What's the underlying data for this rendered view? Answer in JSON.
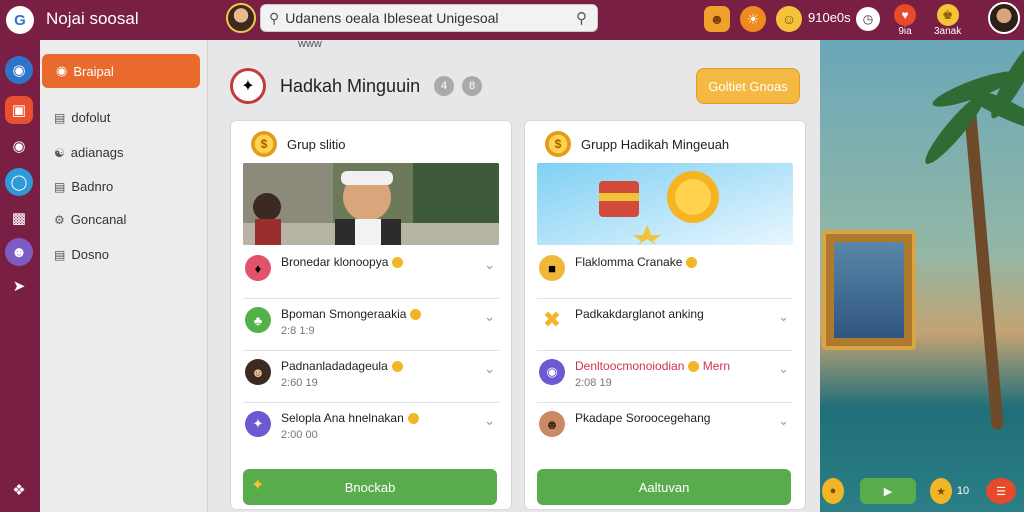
{
  "app": {
    "title": "Nojai soosal",
    "logo_letter": "G"
  },
  "search": {
    "value": "Udanens oeala Ibleseat Unigesoal"
  },
  "top_status": {
    "text": "910e0s"
  },
  "top_minis": [
    {
      "label": "9ia"
    },
    {
      "label": "3anak"
    }
  ],
  "sidebar": {
    "active": "Braipal",
    "items": [
      {
        "label": "dofolut"
      },
      {
        "label": "adianags"
      },
      {
        "label": "Badnro"
      },
      {
        "label": "Goncanal"
      },
      {
        "label": "Dosno"
      }
    ]
  },
  "main": {
    "faded_row": "www",
    "title": "Hadkah Minguuin",
    "badge1": "4",
    "badge2": "8",
    "action_button": "Goltiet Gnoas"
  },
  "left_card": {
    "title": "Grup slitio",
    "rows": [
      {
        "label": "Bronedar klonoopya",
        "sub": ""
      },
      {
        "label": "Bpoman Smongeraakia",
        "sub": "2:8 1:9"
      },
      {
        "label": "Padnanladadageula",
        "sub": "2:60 19"
      },
      {
        "label": "Selopla Ana hnelnakan",
        "sub": "2:00 00"
      }
    ],
    "button": "Bnockab"
  },
  "right_card": {
    "title": "Grupp Hadikah Mingeuah",
    "rows": [
      {
        "label": "Flaklomma Cranake",
        "sub": ""
      },
      {
        "label": "Padkakdarglanot anking",
        "sub": ""
      },
      {
        "label": "Denltoocmonoiodian",
        "label_extra": "Mern",
        "sub": "2:08 19"
      },
      {
        "label": "Pkadape Soroocegehang",
        "sub": ""
      }
    ],
    "button": "Aaltuvan"
  },
  "game_bar": {
    "score": "10"
  },
  "colors": {
    "brand": "#7a1f44",
    "accent": "#e96a2c",
    "success": "#58ac4c",
    "warning": "#f4b942"
  }
}
